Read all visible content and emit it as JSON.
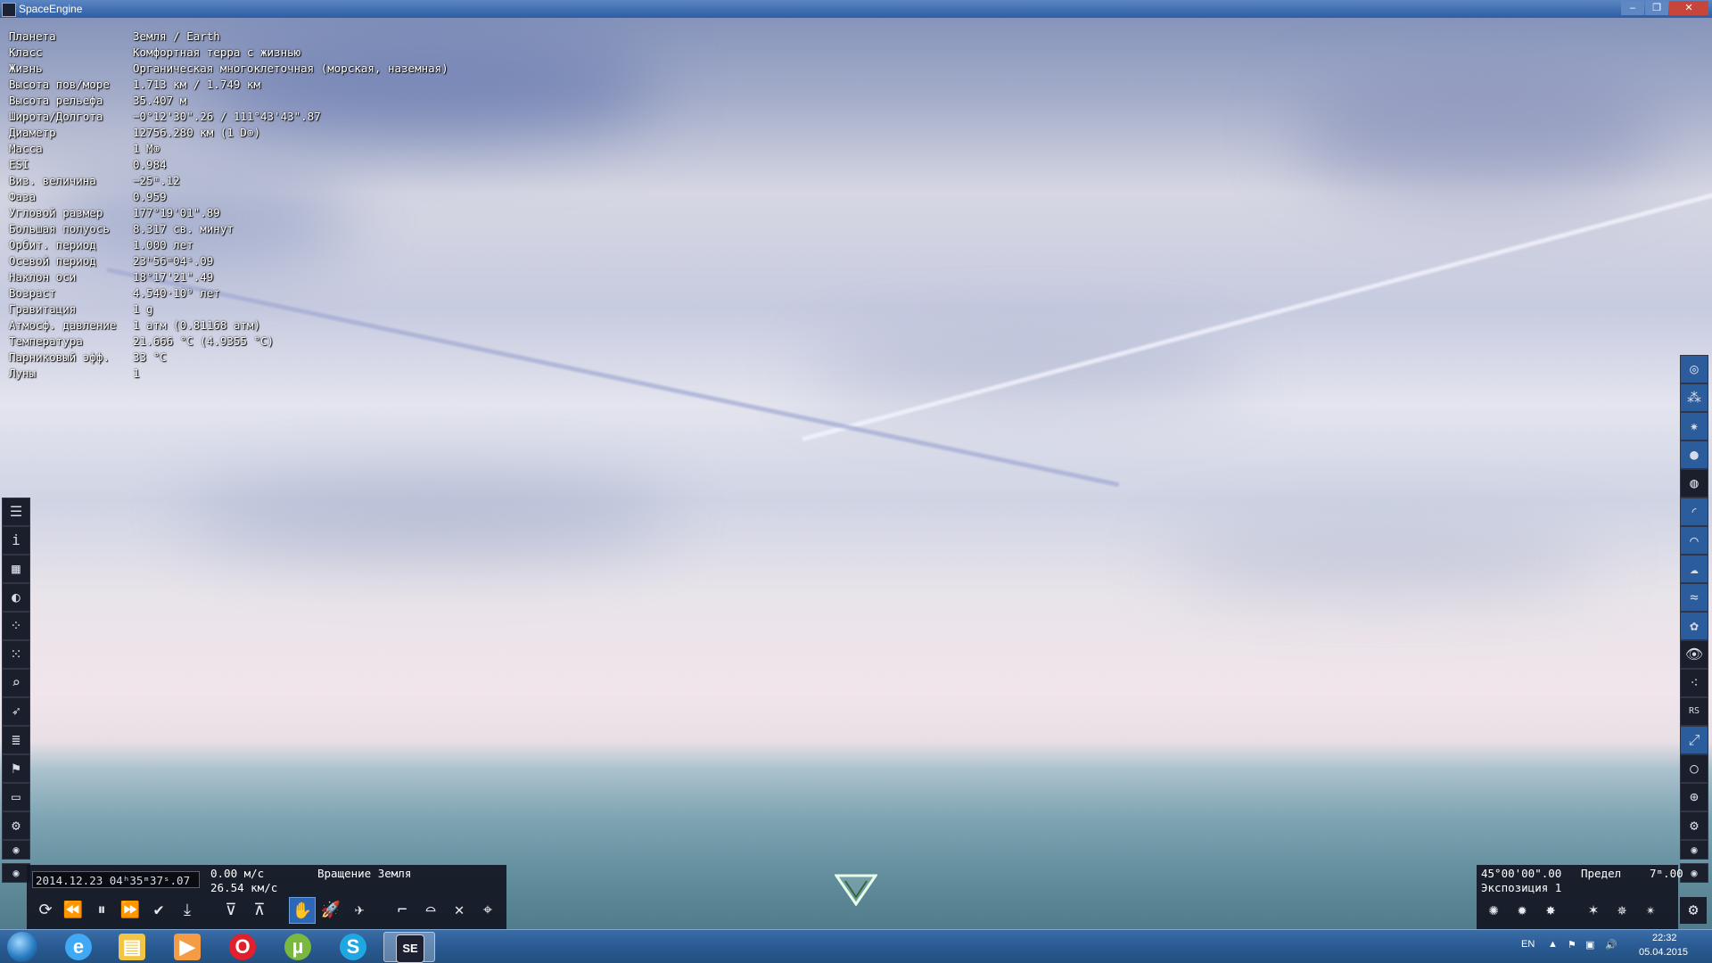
{
  "window": {
    "title": "SpaceEngine",
    "min_glyph": "–",
    "max_glyph": "❐",
    "close_glyph": "✕"
  },
  "info_panel": {
    "rows": [
      {
        "label": "Планета",
        "value": "Земля / Earth"
      },
      {
        "label": "Класс",
        "value": "Комфортная терра с жизнью"
      },
      {
        "label": "Жизнь",
        "value": "Органическая многоклеточная (морская, наземная)"
      },
      {
        "label": "Высота пов/море",
        "value": "1.713 км / 1.749 км"
      },
      {
        "label": "Высота рельефа",
        "value": "35.407 м"
      },
      {
        "label": "Широта/Долгота",
        "value": "−0°12'30\".26 / 111°43'43\".87"
      },
      {
        "label": "Диаметр",
        "value": "12756.280 км (1 D⊕)"
      },
      {
        "label": "Масса",
        "value": "1 M⊕"
      },
      {
        "label": "ESI",
        "value": "0.984"
      },
      {
        "label": "Виз. величина",
        "value": "−25ᵐ.12"
      },
      {
        "label": "Фаза",
        "value": "0.959"
      },
      {
        "label": "Угловой размер",
        "value": "177°19'01\".89"
      },
      {
        "label": "Большая полуось",
        "value": "8.317 св. минут"
      },
      {
        "label": "Орбит. период",
        "value": "1.000 лет"
      },
      {
        "label": "Осевой период",
        "value": "23ʰ56ᵐ04ˢ.09"
      },
      {
        "label": "Наклон оси",
        "value": "18°17'21\".49"
      },
      {
        "label": "Возраст",
        "value": "4.540·10⁹ лет"
      },
      {
        "label": "Гравитация",
        "value": "1 g"
      },
      {
        "label": "Атмосф. давление",
        "value": "1 атм (0.81168 атм)"
      },
      {
        "label": "Температура",
        "value": "21.666 °C (4.9355 °C)"
      },
      {
        "label": "Парниковый эфф.",
        "value": "33 °C"
      },
      {
        "label": "Луны",
        "value": "1"
      }
    ]
  },
  "left_toolbar": [
    {
      "icon": "menu-icon",
      "glyph": "☰"
    },
    {
      "icon": "info-icon",
      "glyph": "i"
    },
    {
      "icon": "city-icon",
      "glyph": "▦"
    },
    {
      "icon": "planet-system-icon",
      "glyph": "◐"
    },
    {
      "icon": "star-map-icon",
      "glyph": "⁘"
    },
    {
      "icon": "galaxy-map-icon",
      "glyph": "⁙"
    },
    {
      "icon": "search-icon",
      "glyph": "⌕"
    },
    {
      "icon": "ship-icon",
      "glyph": "➶"
    },
    {
      "icon": "list-icon",
      "glyph": "≣"
    },
    {
      "icon": "flag-icon",
      "glyph": "⚑"
    },
    {
      "icon": "monitor-icon",
      "glyph": "▭"
    },
    {
      "icon": "settings-icon",
      "glyph": "⚙"
    },
    {
      "icon": "small-target-icon",
      "glyph": "◉"
    },
    {
      "icon": "small-target-icon-2",
      "glyph": "◉"
    }
  ],
  "right_toolbar": [
    {
      "icon": "galaxy-filter-icon",
      "glyph": "◎",
      "active": true
    },
    {
      "icon": "nebula-filter-icon",
      "glyph": "⁂",
      "active": true
    },
    {
      "icon": "star-filter-icon",
      "glyph": "✷",
      "active": true
    },
    {
      "icon": "planet-filter-icon",
      "glyph": "●",
      "active": true
    },
    {
      "icon": "ring-planet-icon",
      "glyph": "◍",
      "active": false
    },
    {
      "icon": "orbit-icon",
      "glyph": "◜",
      "active": true
    },
    {
      "icon": "atmosphere-icon",
      "glyph": "⌒",
      "active": true
    },
    {
      "icon": "cloud-icon",
      "glyph": "☁",
      "active": true
    },
    {
      "icon": "water-icon",
      "glyph": "≈",
      "active": true
    },
    {
      "icon": "life-icon",
      "glyph": "✿",
      "active": true
    },
    {
      "icon": "eye-icon",
      "glyph": "👁",
      "active": false
    },
    {
      "icon": "particles-icon",
      "glyph": "⁖",
      "active": false
    },
    {
      "icon": "rs-icon",
      "glyph": "RS",
      "active": false
    },
    {
      "icon": "expand-icon",
      "glyph": "⤢",
      "active": true
    },
    {
      "icon": "circle-icon",
      "glyph": "○",
      "active": false
    },
    {
      "icon": "globe-grid-icon",
      "glyph": "⊕",
      "active": false
    },
    {
      "icon": "settings-icon",
      "glyph": "⚙",
      "active": false
    },
    {
      "icon": "small-target-icon",
      "glyph": "◉",
      "active": false
    },
    {
      "icon": "small-target-icon-2",
      "glyph": "◉",
      "active": false
    }
  ],
  "time_panel": {
    "datetime": "2014.12.23  04ʰ35ᵐ37ˢ.07",
    "speed": "0.00  м/с",
    "velocity": "26.54  км/с",
    "mode": "Вращение  Земля",
    "buttons": [
      {
        "icon": "realtime-icon",
        "glyph": "⟳"
      },
      {
        "icon": "rewind-icon",
        "glyph": "⏪"
      },
      {
        "icon": "pause-icon",
        "glyph": "⏸"
      },
      {
        "icon": "forward-icon",
        "glyph": "⏩"
      },
      {
        "icon": "check-icon",
        "glyph": "✔"
      },
      {
        "icon": "land-icon",
        "glyph": "⤓"
      },
      {
        "icon": "down-arrow-icon",
        "glyph": "⊽"
      },
      {
        "icon": "up-arrow-icon",
        "glyph": "⊼"
      },
      {
        "icon": "free-mode-icon",
        "glyph": "✋",
        "active": true
      },
      {
        "icon": "ship-mode-icon",
        "glyph": "🚀"
      },
      {
        "icon": "aircraft-mode-icon",
        "glyph": "✈"
      },
      {
        "icon": "telescope-icon",
        "glyph": "⌐"
      },
      {
        "icon": "orbit-mode-icon",
        "glyph": "⌓"
      },
      {
        "icon": "cross-icon",
        "glyph": "✕"
      },
      {
        "icon": "crosshair-icon",
        "glyph": "⌖"
      }
    ]
  },
  "camera_panel": {
    "fov": "45°00'00\".00",
    "limit_label": "Предел",
    "limit_value": "7ᵐ.00",
    "exposure": "Экспозиция 1",
    "buttons": [
      {
        "icon": "sun-dim-icon",
        "glyph": "✺"
      },
      {
        "icon": "sun-auto-icon",
        "glyph": "✹"
      },
      {
        "icon": "sun-bright-icon",
        "glyph": "✸"
      },
      {
        "icon": "star-dim-icon",
        "glyph": "✶"
      },
      {
        "icon": "star-auto-icon",
        "glyph": "✵"
      },
      {
        "icon": "star-bright-icon",
        "glyph": "✴"
      }
    ]
  },
  "taskbar": {
    "apps": [
      {
        "icon": "internet-explorer-icon",
        "glyph": "e",
        "color": "#3fa9f5"
      },
      {
        "icon": "file-explorer-icon",
        "glyph": "▤",
        "color": "#f2c544"
      },
      {
        "icon": "media-player-icon",
        "glyph": "▶",
        "color": "#f39c45"
      },
      {
        "icon": "opera-icon",
        "glyph": "O",
        "color": "#e0202c"
      },
      {
        "icon": "utorrent-icon",
        "glyph": "µ",
        "color": "#7ab83f"
      },
      {
        "icon": "skype-icon",
        "glyph": "S",
        "color": "#1ea7e1"
      },
      {
        "icon": "spaceengine-icon",
        "glyph": "SE",
        "color": "#1c2030",
        "active": true
      }
    ],
    "language": "EN",
    "time": "22:32",
    "date": "05.04.2015"
  }
}
